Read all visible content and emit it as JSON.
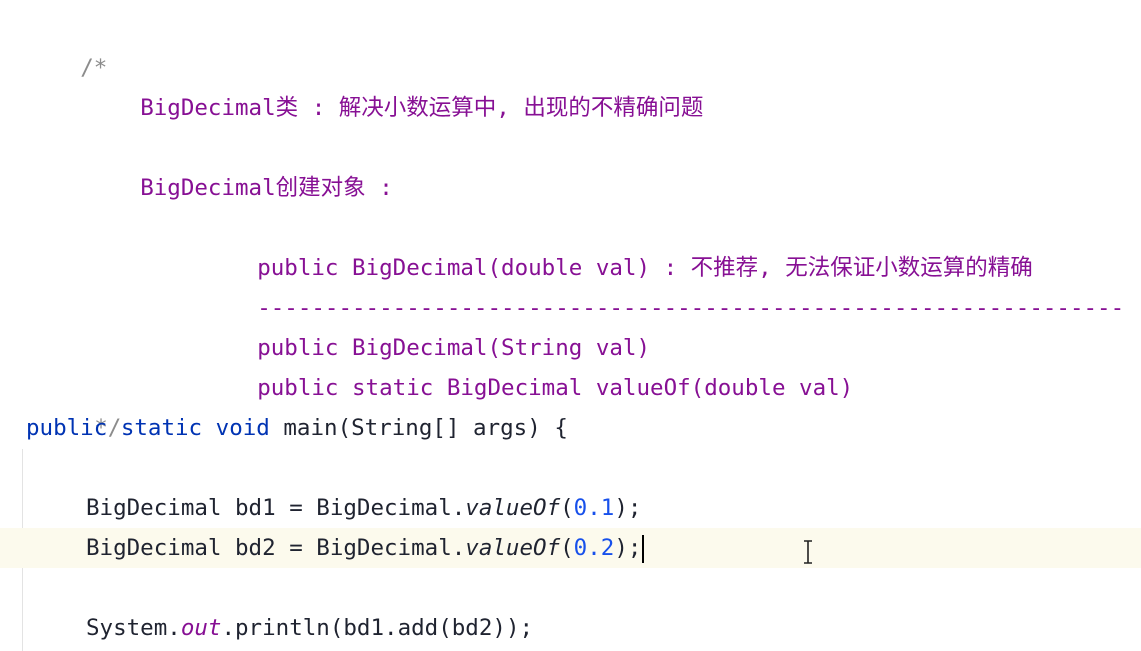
{
  "code": {
    "comment_open": "/*",
    "doc_line_1": "BigDecimal类 : 解决小数运算中, 出现的不精确问题",
    "doc_line_2": "BigDecimal创建对象 :",
    "doc_line_3": "public BigDecimal(double val) : 不推荐, 无法保证小数运算的精确",
    "doc_divider": "----------------------------------------------------------------",
    "doc_line_4": "public BigDecimal(String val)",
    "doc_line_5": "public static BigDecimal valueOf(double val)",
    "comment_close": "*/",
    "main_kw1": "public",
    "main_kw2": "static",
    "main_kw3": "void",
    "main_rest": "main(String[] args) {",
    "bd1_decl": "BigDecimal bd1 = BigDecimal.",
    "bd1_call": "valueOf",
    "bd1_paren_open": "(",
    "bd1_num": "0.1",
    "bd1_end": ");",
    "bd2_decl": "BigDecimal bd2 = BigDecimal.",
    "bd2_call": "valueOf",
    "bd2_paren_open": "(",
    "bd2_num": "0.2",
    "bd2_end": ");",
    "print_sys": "System.",
    "print_out": "out",
    "print_rest": ".println(bd1.add(bd2));"
  },
  "colors": {
    "comment": "#8c8c8c",
    "doc": "#871094",
    "keyword": "#0033b3",
    "number": "#1750eb",
    "current_line": "#fcfaed"
  }
}
